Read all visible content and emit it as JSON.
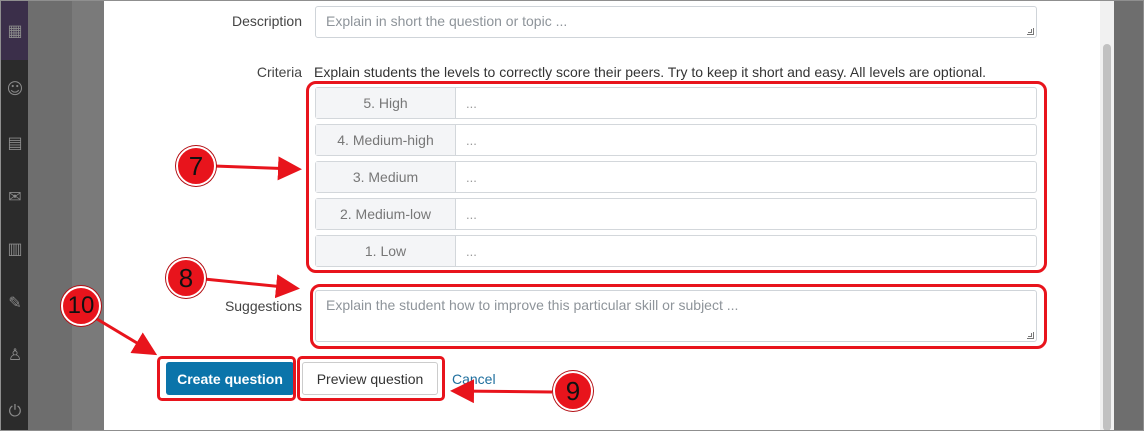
{
  "form": {
    "description_label": "Description",
    "description_placeholder": "Explain in short the question or topic ...",
    "criteria_label": "Criteria",
    "criteria_hint": "Explain students the levels to correctly score their peers. Try to keep it short and easy. All levels are optional.",
    "levels": [
      {
        "label": "5. High",
        "placeholder": "..."
      },
      {
        "label": "4. Medium-high",
        "placeholder": "..."
      },
      {
        "label": "3. Medium",
        "placeholder": "..."
      },
      {
        "label": "2. Medium-low",
        "placeholder": "..."
      },
      {
        "label": "1. Low",
        "placeholder": "..."
      }
    ],
    "suggestions_label": "Suggestions",
    "suggestions_placeholder": "Explain the student how to improve this particular skill or subject ..."
  },
  "actions": {
    "create_label": "Create question",
    "preview_label": "Preview question",
    "cancel_label": "Cancel"
  },
  "annotations": {
    "criteria_marker": "7",
    "suggestions_marker": "8",
    "preview_marker": "9",
    "create_marker": "10",
    "color": "#e8141c"
  },
  "colors": {
    "primary": "#0b74aa",
    "link": "#1f6f9e"
  },
  "sidebar_icons": [
    "apps-icon",
    "users-icon",
    "calendar-icon",
    "mail-icon",
    "document-icon",
    "edit-icon",
    "person-icon",
    "logout-icon"
  ]
}
